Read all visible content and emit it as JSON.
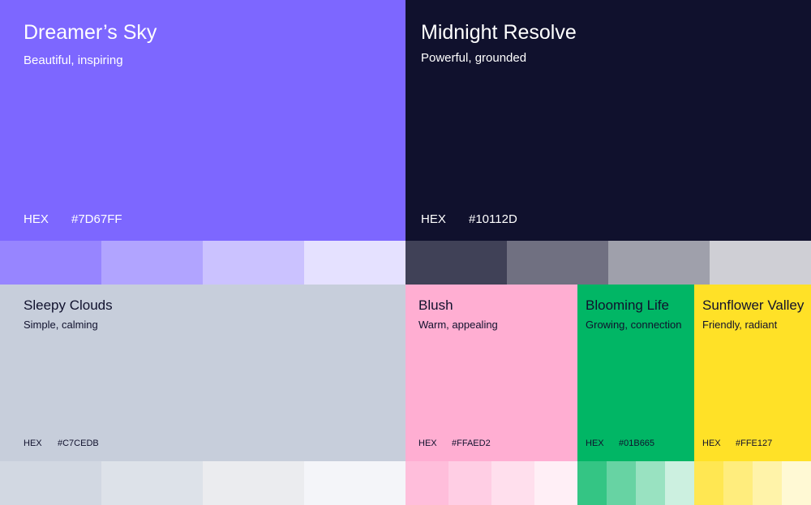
{
  "swatches": [
    {
      "id": "dreamer",
      "name": "Dreamer’s Sky",
      "description": "Beautiful, inspiring",
      "hex_label": "HEX",
      "hex": "#7D67FF",
      "text_color": "#FFFFFF",
      "tints": [
        "#9785FF",
        "#B1A4FF",
        "#CBC2FF",
        "#E5E1FF"
      ]
    },
    {
      "id": "midnight",
      "name": "Midnight Resolve",
      "description": "Powerful, grounded",
      "hex_label": "HEX",
      "hex": "#10112D",
      "text_color": "#FFFFFF",
      "tints": [
        "#404157",
        "#707081",
        "#9FA0AB",
        "#CFCFD5"
      ]
    },
    {
      "id": "sleepy",
      "name": "Sleepy Clouds",
      "description": "Simple, calming",
      "hex_label": "HEX",
      "hex": "#C7CEDB",
      "text_color": "#10112D",
      "tints": [
        "#D2D8E2",
        "#DDE2E9",
        "#EBECEF",
        "#F4F5F9"
      ]
    },
    {
      "id": "blush",
      "name": "Blush",
      "description": "Warm, appealing",
      "hex_label": "HEX",
      "hex": "#FFAED2",
      "text_color": "#10112D",
      "tints": [
        "#FFBEDB",
        "#FFCEE4",
        "#FFDFED",
        "#FFEFF6"
      ]
    },
    {
      "id": "blooming",
      "name": "Blooming Life",
      "description": "Growing, connection",
      "hex_label": "HEX",
      "hex": "#01B665",
      "text_color": "#10112D",
      "tints": [
        "#34C584",
        "#67D3A3",
        "#99E2C1",
        "#CCF0E0"
      ]
    },
    {
      "id": "sunflower",
      "name": "Sunflower Valley",
      "description": "Friendly, radiant",
      "hex_label": "HEX",
      "hex": "#FFE127",
      "text_color": "#10112D",
      "tints": [
        "#FFE752",
        "#FFED7D",
        "#FFF3A9",
        "#FFF9D4"
      ]
    }
  ]
}
